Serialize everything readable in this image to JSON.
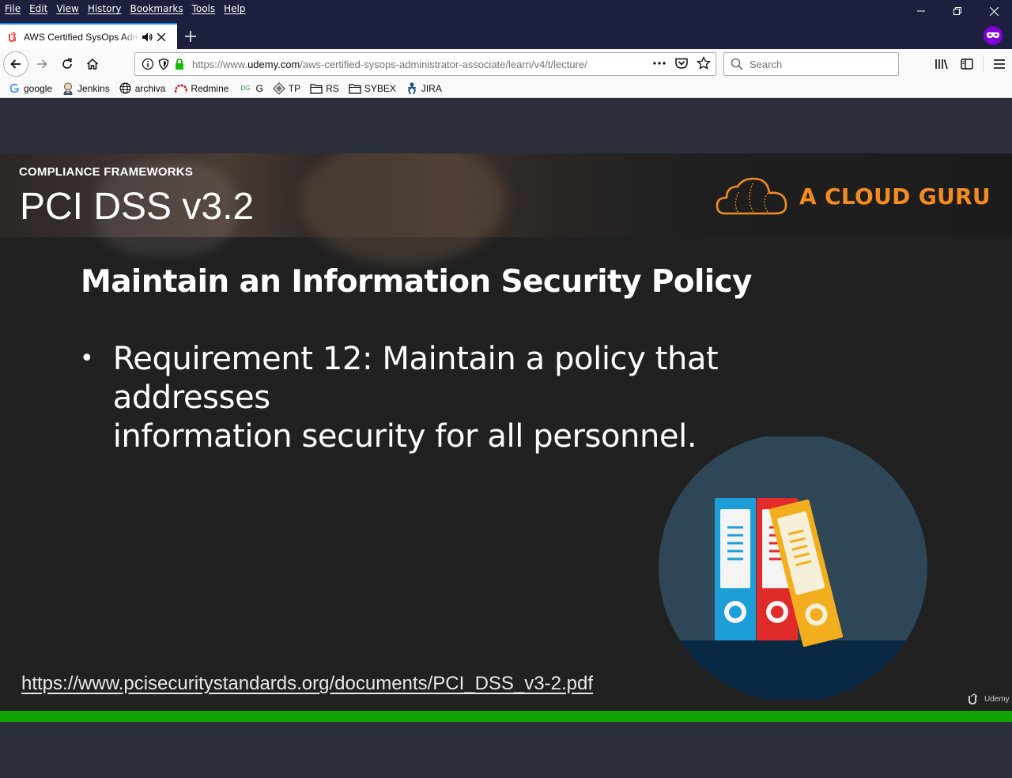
{
  "menu": {
    "items": [
      "File",
      "Edit",
      "View",
      "History",
      "Bookmarks",
      "Tools",
      "Help"
    ]
  },
  "tab": {
    "title": "AWS Certified SysOps Administrator - Associate"
  },
  "address": {
    "url_prefix": "https://www.",
    "url_host": "udemy.com",
    "url_path": "/aws-certified-sysops-administrator-associate/learn/v4/t/lecture/"
  },
  "search": {
    "placeholder": "Search"
  },
  "bookmarks": [
    {
      "label": "google",
      "icon": "google-icon"
    },
    {
      "label": "Jenkins",
      "icon": "jenkins-icon"
    },
    {
      "label": "archiva",
      "icon": "globe-icon"
    },
    {
      "label": "Redmine",
      "icon": "redmine-icon"
    },
    {
      "label": "G",
      "icon": "dg-icon"
    },
    {
      "label": "TP",
      "icon": "tp-icon"
    },
    {
      "label": "RS",
      "icon": "folder-icon"
    },
    {
      "label": "SYBEX",
      "icon": "folder-icon"
    },
    {
      "label": "JIRA",
      "icon": "jira-icon"
    }
  ],
  "slide": {
    "kicker": "COMPLIANCE FRAMEWORKS",
    "title": "PCI DSS v3.2",
    "brand": "A CLOUD GURU",
    "heading": "Maintain an Information Security Policy",
    "bullet_line1": "Requirement 12: Maintain a policy that addresses",
    "bullet_line2": "information security for all personnel.",
    "link": "https://www.pcisecuritystandards.org/documents/PCI_DSS_v3-2.pdf",
    "watermark": "Udemy"
  },
  "colors": {
    "accent_brand": "#f28b22",
    "progress": "#13a300",
    "private_badge": "#8000d7"
  }
}
